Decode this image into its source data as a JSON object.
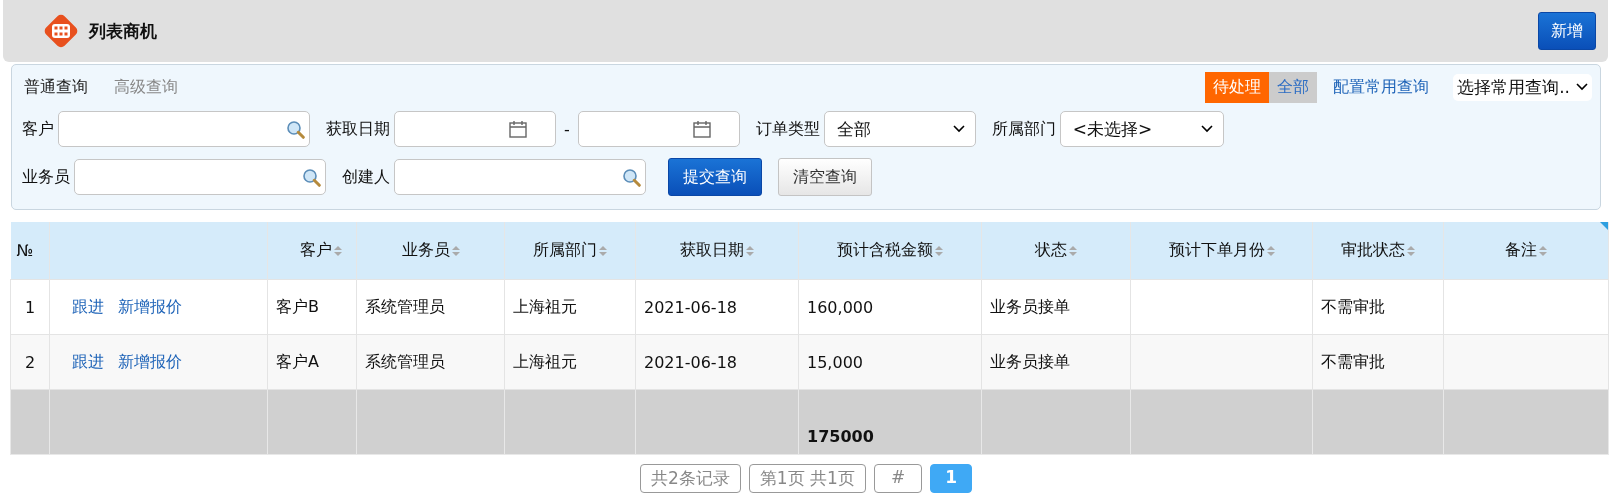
{
  "header": {
    "title": "列表商机",
    "add_button": "新增"
  },
  "query": {
    "tabs": [
      {
        "label": "普通查询",
        "selected": true
      },
      {
        "label": "高级查询",
        "selected": false
      }
    ],
    "status_filter": [
      {
        "label": "待处理",
        "selected": true
      },
      {
        "label": "全部",
        "selected": false
      }
    ],
    "configure_link": "配置常用查询",
    "saved_query": {
      "value": "选择常用查询.."
    },
    "first_line": {
      "fields": [
        {
          "kind": "lookup",
          "label": "客户"
        },
        {
          "kind": "date-range",
          "label": "获取日期",
          "separator": "-"
        },
        {
          "kind": "select",
          "label": "订单类型",
          "value": "全部"
        },
        {
          "kind": "select",
          "label": "所属部门",
          "value": "<未选择>"
        }
      ]
    },
    "second_line": {
      "fields": [
        {
          "kind": "lookup",
          "label": "业务员"
        },
        {
          "kind": "lookup",
          "label": "创建人"
        }
      ],
      "submit_button": "提交查询",
      "clear_button": "清空查询"
    }
  },
  "table": {
    "columns": [
      {
        "label": "№"
      },
      {},
      {
        "label": "客户",
        "sortable": true
      },
      {
        "label": "业务员",
        "sortable": true
      },
      {
        "label": "所属部门",
        "sortable": true
      },
      {
        "label": "获取日期",
        "sortable": true
      },
      {
        "label": "预计含税金额",
        "sortable": true
      },
      {
        "label": "状态",
        "sortable": true
      },
      {
        "label": "预计下单月份",
        "sortable": true
      },
      {
        "label": "审批状态",
        "sortable": true
      },
      {
        "label": "备注",
        "sortable": true
      }
    ],
    "rows": [
      {
        "cells": [
          {
            "text": "1"
          },
          {
            "links": [
              "跟进",
              "新增报价"
            ]
          },
          {
            "text": "客户B"
          },
          {
            "text": "系统管理员"
          },
          {
            "text": "上海祖元"
          },
          {
            "text": "2021-06-18"
          },
          {
            "text": "160,000"
          },
          {
            "text": "业务员接单"
          },
          {},
          {
            "text": "不需审批"
          },
          {}
        ]
      },
      {
        "cells": [
          {
            "text": "2"
          },
          {
            "links": [
              "跟进",
              "新增报价"
            ]
          },
          {
            "text": "客户A"
          },
          {
            "text": "系统管理员"
          },
          {
            "text": "上海祖元"
          },
          {
            "text": "2021-06-18"
          },
          {
            "text": "15,000"
          },
          {
            "text": "业务员接单"
          },
          {},
          {
            "text": "不需审批"
          },
          {}
        ]
      }
    ],
    "total_row": {
      "cells": [
        {},
        {},
        {},
        {},
        {},
        {},
        {
          "text": "175000"
        },
        {},
        {},
        {},
        {}
      ]
    }
  },
  "pager": {
    "record_count": "共2条记录",
    "page_info": "第1页 共1页",
    "jump": "#",
    "pages": [
      {
        "label": "1",
        "selected": true
      }
    ]
  }
}
